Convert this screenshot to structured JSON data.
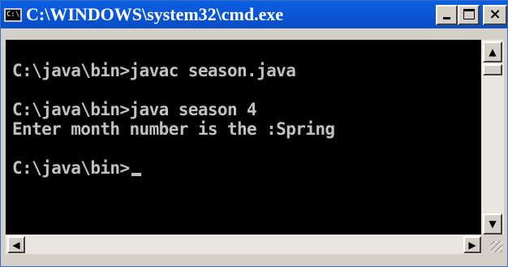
{
  "window": {
    "icon_text": "C:\\",
    "title": "C:\\WINDOWS\\system32\\cmd.exe",
    "buttons": {
      "minimize": "minimize-icon",
      "maximize": "maximize-icon",
      "close_label": "×"
    }
  },
  "console": {
    "lines": [
      "C:\\java\\bin>javac season.java",
      "C:\\java\\bin>java season 4",
      "Enter month number is the :Spring",
      "C:\\java\\bin>"
    ],
    "text_color": "#c0c0c0",
    "background": "#000000"
  },
  "scrollbars": {
    "up_arrow": "▲",
    "down_arrow": "▼",
    "left_arrow": "◀",
    "right_arrow": "▶"
  },
  "colors": {
    "titlebar": "#0a58d8",
    "frame": "#d4d0c8"
  }
}
